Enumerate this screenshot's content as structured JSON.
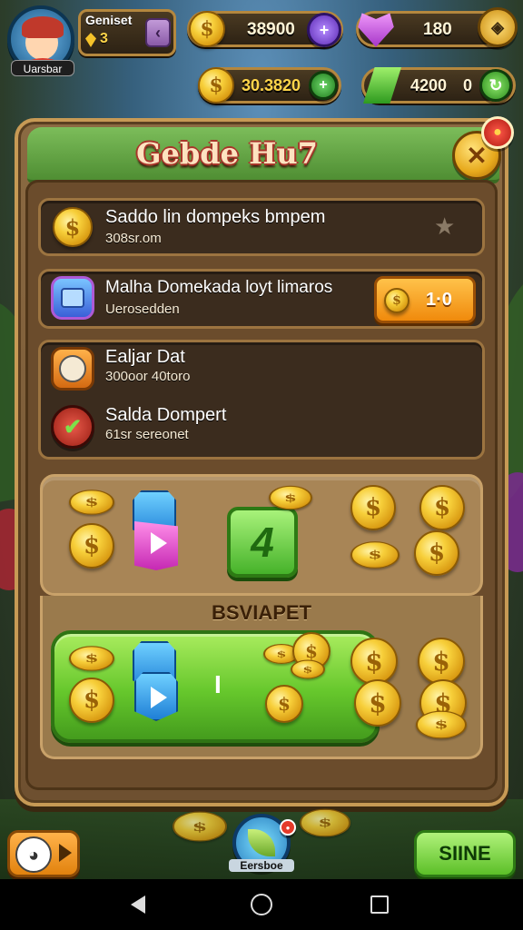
{
  "header": {
    "player_title": "Geniset",
    "player_level": "3",
    "player_name": "Uarsbar",
    "coins_top": "38900",
    "hearts": "180",
    "coins_second": "30.3820",
    "gems": "4200",
    "gems_extra": "0"
  },
  "panel": {
    "title": "Gebde Hu7"
  },
  "rows": [
    {
      "title": "Saddo lin dompeks bmpem",
      "subtitle": "308sr.om"
    },
    {
      "title": "Malha Domekada loyt limaros",
      "subtitle": "Uerosedden",
      "button": "1·0"
    },
    {
      "title": "Ealjar Dat",
      "subtitle": "300oor 40toro"
    },
    {
      "title": "Salda Dompert",
      "subtitle": "61sr sereonet"
    }
  ],
  "reward": {
    "badge": "4",
    "label": "BSVIAPET",
    "bar_divider": "I"
  },
  "bottom": {
    "center_label": "Eersboe",
    "share_button": "SIINE"
  },
  "colors": {
    "panel_border": "#c79a55",
    "title_green": "#4f8e33",
    "gold": "#f7cf3a",
    "orange_button": "#f39a1a",
    "share_green": "#66c72c"
  }
}
